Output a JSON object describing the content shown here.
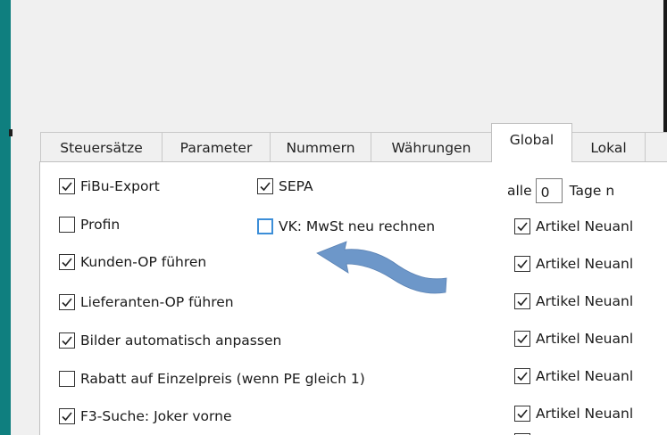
{
  "colors": {
    "accent_left_strip": "#0f7f7f",
    "arrow_fill": "#6d97c9",
    "unchecked_blue_box": "#3c8ed8"
  },
  "tabs": [
    {
      "label": "Steuersätze",
      "active": false
    },
    {
      "label": "Parameter",
      "active": false
    },
    {
      "label": "Nummern",
      "active": false
    },
    {
      "label": "Währungen",
      "active": false
    },
    {
      "label": "Global",
      "active": true
    },
    {
      "label": "Lokal",
      "active": false
    },
    {
      "label": "",
      "active": false
    }
  ],
  "options": {
    "fibu_export": {
      "label": "FiBu-Export",
      "checked": true
    },
    "sepa": {
      "label": "SEPA",
      "checked": true
    },
    "profin": {
      "label": "Profin",
      "checked": false
    },
    "vk_mwst": {
      "label": "VK: MwSt neu rechnen",
      "checked": false
    },
    "kunden_op": {
      "label": "Kunden-OP führen",
      "checked": true
    },
    "lieferanten_op": {
      "label": "Lieferanten-OP führen",
      "checked": true
    },
    "bilder": {
      "label": "Bilder automatisch anpassen",
      "checked": true
    },
    "rabatt": {
      "label": "Rabatt auf Einzelpreis (wenn PE gleich 1)",
      "checked": false
    },
    "f3_suche": {
      "label": "F3-Suche: Joker vorne",
      "checked": true
    }
  },
  "right_column": {
    "alle_label": "alle",
    "days_value": "0",
    "tage_label": "Tage n",
    "artikel_items": [
      {
        "label": "Artikel Neuanl",
        "checked": true
      },
      {
        "label": "Artikel Neuanl",
        "checked": true
      },
      {
        "label": "Artikel Neuanl",
        "checked": true
      },
      {
        "label": "Artikel Neuanl",
        "checked": true
      },
      {
        "label": "Artikel Neuanl",
        "checked": true
      },
      {
        "label": "Artikel Neuanl",
        "checked": true
      }
    ]
  },
  "annotation": {
    "arrow_icon": "curved-arrow-left-icon"
  }
}
